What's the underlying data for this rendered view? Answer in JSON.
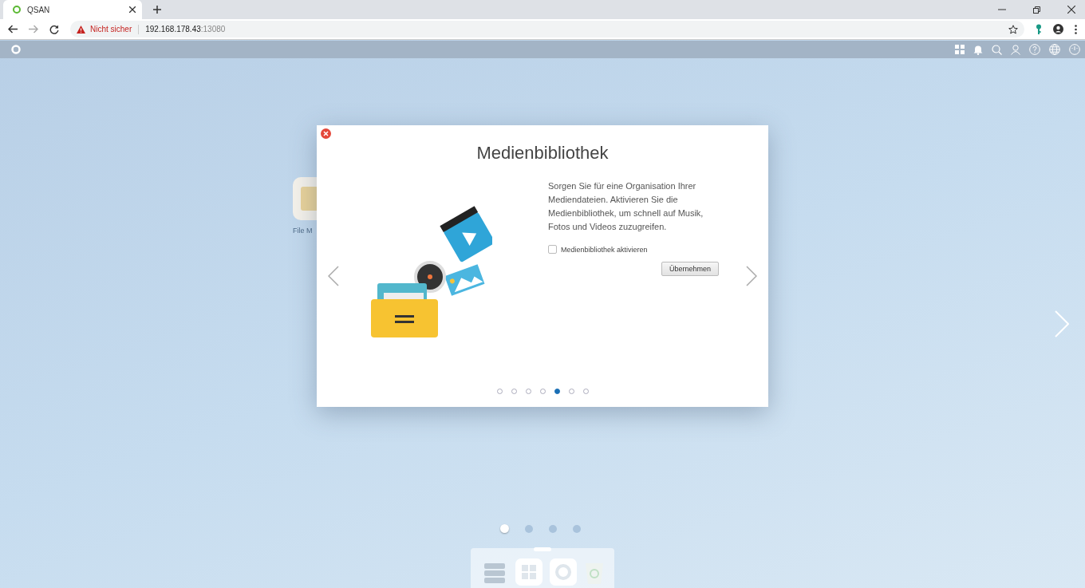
{
  "browser": {
    "tab": {
      "title": "QSAN"
    },
    "security": "Nicht sicher",
    "url_host": "192.168.178.43",
    "url_port": ":13080"
  },
  "desktop_icons": [
    {
      "label": "File M"
    }
  ],
  "dialog": {
    "title": "Medienbibliothek",
    "description": "Sorgen Sie für eine Organisation Ihrer Mediendateien. Aktivieren Sie die Medienbibliothek, um schnell auf Musik, Fotos und Videos zuzugreifen.",
    "checkbox": {
      "label": "Medienbibliothek aktivieren",
      "checked": false
    },
    "button": "Übernehmen",
    "pages": [
      {
        "selected": false
      },
      {
        "selected": false
      },
      {
        "selected": false
      },
      {
        "selected": false
      },
      {
        "selected": true
      },
      {
        "selected": false
      },
      {
        "selected": false
      }
    ]
  },
  "desktop_pages": [
    {
      "selected": true
    },
    {
      "selected": false
    },
    {
      "selected": false
    },
    {
      "selected": false
    }
  ]
}
